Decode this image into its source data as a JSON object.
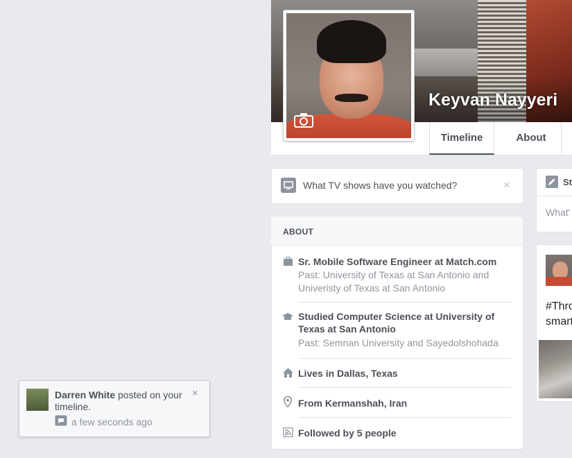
{
  "profile": {
    "name": "Keyvan Nayyeri",
    "camera_icon": "camera-icon"
  },
  "nav": {
    "tabs": [
      {
        "label": "Timeline",
        "active": true
      },
      {
        "label": "About",
        "active": false
      }
    ]
  },
  "tv_prompt": {
    "icon": "tv-icon",
    "text": "What TV shows have you watched?",
    "close": "×"
  },
  "about": {
    "title": "ABOUT",
    "items": [
      {
        "icon": "briefcase-icon",
        "main": "Sr. Mobile Software Engineer at Match.com",
        "sub": "Past: University of Texas at San Antonio and Univeristy of Texas at San Antonio"
      },
      {
        "icon": "graduation-cap-icon",
        "main": "Studied Computer Science at University of Texas at San Antonio",
        "sub": "Past: Semnan University and Sayedolshohada"
      },
      {
        "icon": "home-icon",
        "main": "Lives in Dallas, Texas",
        "sub": ""
      },
      {
        "icon": "location-pin-icon",
        "main": "From Kermanshah, Iran",
        "sub": ""
      },
      {
        "icon": "rss-feed-icon",
        "main": "Followed by 5 people",
        "sub": ""
      }
    ]
  },
  "status_card": {
    "label": "St",
    "placeholder": "What'"
  },
  "post_card": {
    "text_line1": "#Thro",
    "text_line2": "smart"
  },
  "notification": {
    "actor": "Darren White",
    "message": " posted on your timeline.",
    "time": "a few seconds ago",
    "close": "×"
  },
  "colors": {
    "page_bg": "#e9eaed",
    "text_primary": "#4b4f56",
    "text_secondary": "#90949c",
    "icon_gray": "#8d949e"
  }
}
